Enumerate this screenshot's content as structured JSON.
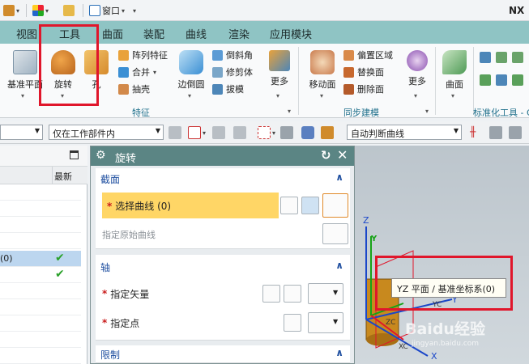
{
  "app": {
    "title": "NX"
  },
  "quick_access": {
    "window_label": "窗口"
  },
  "menu_tabs": [
    "视图",
    "工具",
    "曲面",
    "装配",
    "曲线",
    "渲染",
    "应用模块"
  ],
  "ribbon": {
    "datum_plane": "基准平面",
    "revolve": "旋转",
    "hole": "孔",
    "pattern_feature": "阵列特征",
    "unite": "合并",
    "shell": "抽壳",
    "edge_blend": "边倒圆",
    "chamfer": "倒斜角",
    "trim_body": "修剪体",
    "draft": "拔模",
    "more_1": "更多",
    "move_face": "移动面",
    "offset_region": "偏置区域",
    "replace_face": "替换面",
    "delete_face": "删除面",
    "more_2": "更多",
    "surface": "曲面",
    "group_feature": "特征",
    "group_sync": "同步建模",
    "group_standard": "标准化工具 - G"
  },
  "selection_bar": {
    "scope_filter": "仅在工作部件内",
    "curve_rule": "自动判断曲线"
  },
  "navigator": {
    "col_latest": "最新",
    "selected_row_text": "(0)"
  },
  "dialog": {
    "title": "旋转",
    "section_profile": "截面",
    "select_curve": "选择曲线 (0)",
    "specify_origin_curve": "指定原始曲线",
    "section_axis": "轴",
    "specify_vector": "指定矢量",
    "specify_point": "指定点",
    "section_limits": "限制"
  },
  "viewport": {
    "tooltip": "YZ 平面 / 基准坐标系(0)",
    "axis_z": "Z",
    "axis_y": "Y",
    "axis_x": "X",
    "axis_zc": "ZC",
    "axis_yc": "YC",
    "axis_xc": "XC",
    "watermark": "Baidu经验",
    "watermark_url": "jingyan.baidu.com"
  },
  "colors": {
    "tab_bar": "#8fc4c4",
    "dialog_title": "#5b8584",
    "highlight": "#ffd666",
    "annotation": "#e0162b"
  }
}
